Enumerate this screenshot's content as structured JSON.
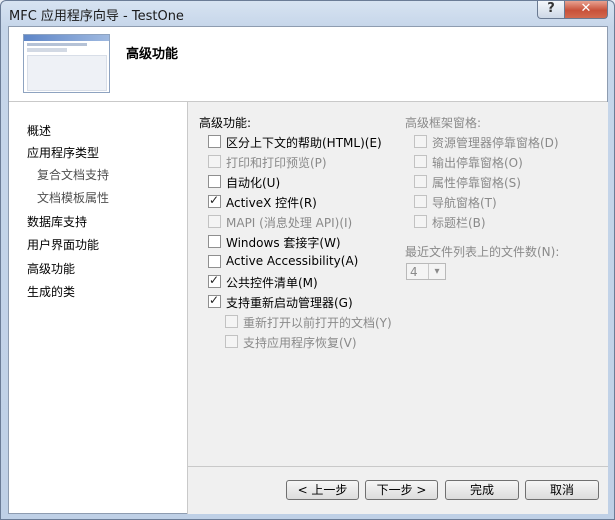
{
  "window": {
    "title": "MFC 应用程序向导 - TestOne",
    "help_button": "?",
    "close_button": "✕"
  },
  "header": {
    "title": "高级功能"
  },
  "sidebar": {
    "items": [
      {
        "label": "概述"
      },
      {
        "label": "应用程序类型"
      },
      {
        "label": "复合文档支持"
      },
      {
        "label": "文档模板属性"
      },
      {
        "label": "数据库支持"
      },
      {
        "label": "用户界面功能"
      },
      {
        "label": "高级功能"
      },
      {
        "label": "生成的类"
      }
    ]
  },
  "advanced": {
    "group_label": "高级功能:",
    "options": [
      {
        "label": "区分上下文的帮助(HTML)(E)",
        "checked": false,
        "enabled": true
      },
      {
        "label": "打印和打印预览(P)",
        "checked": false,
        "enabled": false
      },
      {
        "label": "自动化(U)",
        "checked": false,
        "enabled": true
      },
      {
        "label": "ActiveX 控件(R)",
        "checked": true,
        "enabled": true
      },
      {
        "label": "MAPI (消息处理 API)(I)",
        "checked": false,
        "enabled": false
      },
      {
        "label": "Windows 套接字(W)",
        "checked": false,
        "enabled": true
      },
      {
        "label": "Active Accessibility(A)",
        "checked": false,
        "enabled": true
      },
      {
        "label": "公共控件清单(M)",
        "checked": true,
        "enabled": true
      },
      {
        "label": "支持重新启动管理器(G)",
        "checked": true,
        "enabled": true
      }
    ],
    "sub_options": [
      {
        "label": "重新打开以前打开的文档(Y)",
        "checked": false,
        "enabled": false
      },
      {
        "label": "支持应用程序恢复(V)",
        "checked": false,
        "enabled": false
      }
    ]
  },
  "frame_panes": {
    "group_label": "高级框架窗格:",
    "options": [
      {
        "label": "资源管理器停靠窗格(D)",
        "checked": false,
        "enabled": false
      },
      {
        "label": "输出停靠窗格(O)",
        "checked": false,
        "enabled": false
      },
      {
        "label": "属性停靠窗格(S)",
        "checked": false,
        "enabled": false
      },
      {
        "label": "导航窗格(T)",
        "checked": false,
        "enabled": false
      },
      {
        "label": "标题栏(B)",
        "checked": false,
        "enabled": false
      }
    ]
  },
  "mru": {
    "label": "最近文件列表上的文件数(N):",
    "value": "4",
    "arrow": "▾"
  },
  "buttons": {
    "prev": "< 上一步",
    "next": "下一步 >",
    "finish": "完成",
    "cancel": "取消"
  }
}
